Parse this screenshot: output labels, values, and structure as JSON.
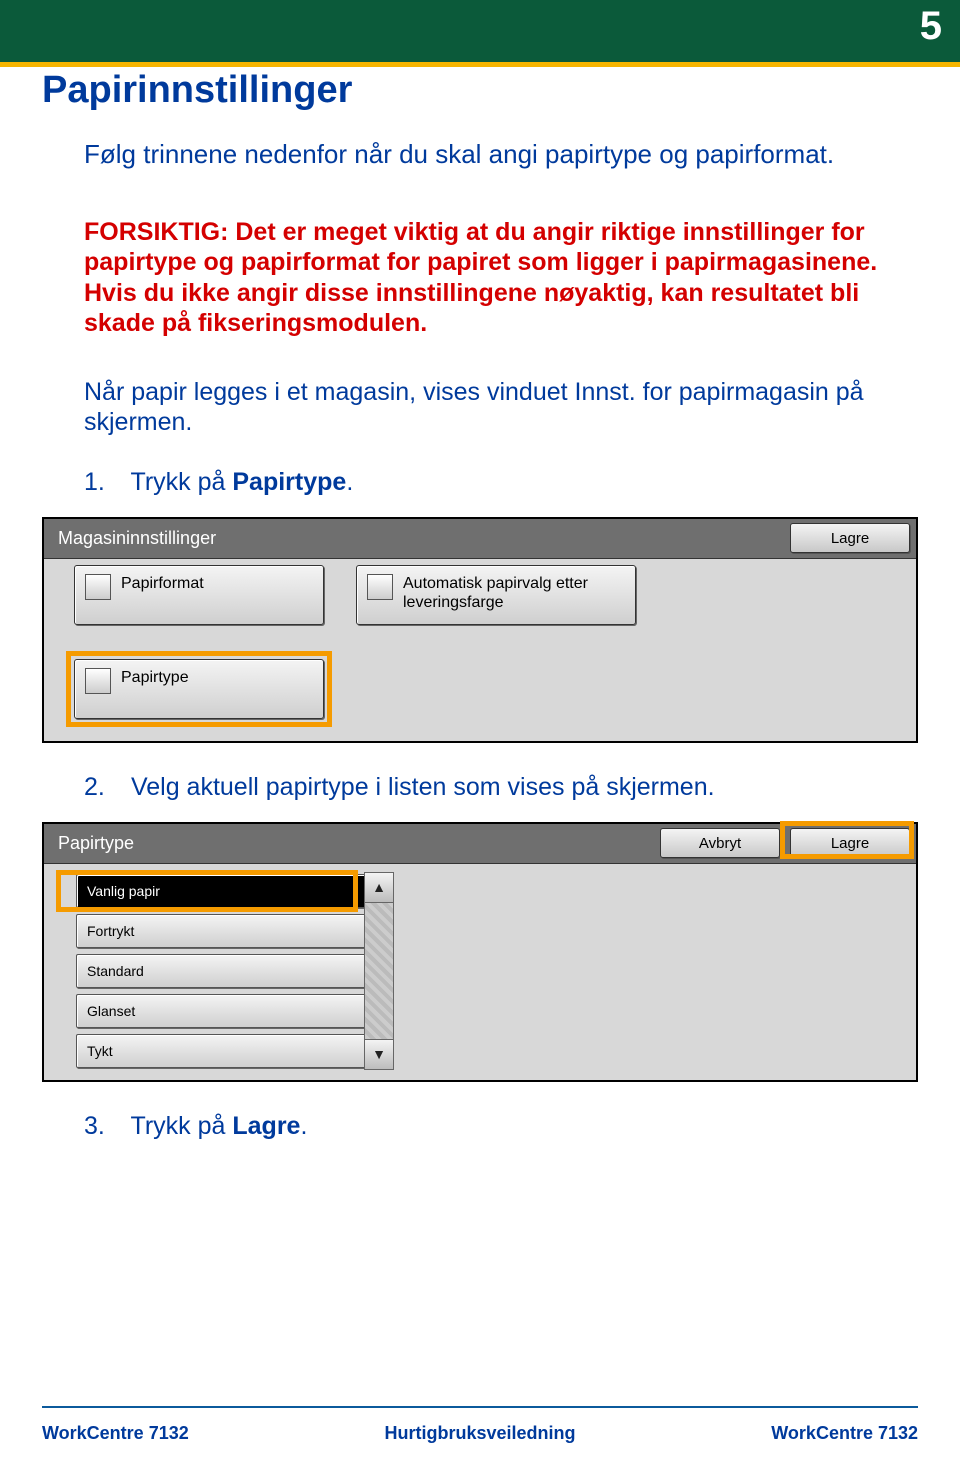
{
  "page_number": "5",
  "title": "Papirinnstillinger",
  "intro": "Følg trinnene nedenfor når du skal angi papirtype og papirformat.",
  "warning": "FORSIKTIG: Det er meget viktig at du angir riktige innstillinger for papirtype og papirformat for papiret som ligger i papirmagasinene. Hvis du ikke angir disse innstillingene nøyaktig, kan resultatet bli skade på fikseringsmodulen.",
  "note": "Når papir legges i et magasin, vises vinduet Innst. for papirmagasin på skjermen.",
  "steps": {
    "s1_num": "1.",
    "s1_text_a": "Trykk på ",
    "s1_text_b": "Papirtype",
    "s1_text_c": ".",
    "s2_num": "2.",
    "s2_text": "Velg aktuell papirtype i listen som vises på skjermen.",
    "s3_num": "3.",
    "s3_text_a": "Trykk på ",
    "s3_text_b": "Lagre",
    "s3_text_c": "."
  },
  "panel1": {
    "title": "Magasininnstillinger",
    "save": "Lagre",
    "papirformat": "Papirformat",
    "autopapir": "Automatisk papirvalg etter leveringsfarge",
    "papirtype": "Papirtype"
  },
  "panel2": {
    "title": "Papirtype",
    "cancel": "Avbryt",
    "save": "Lagre",
    "items": [
      "Vanlig papir",
      "Fortrykt",
      "Standard",
      "Glanset",
      "Tykt"
    ]
  },
  "footer": {
    "left": "WorkCentre 7132",
    "center": "Hurtigbruksveiledning",
    "right": "WorkCentre 7132"
  }
}
